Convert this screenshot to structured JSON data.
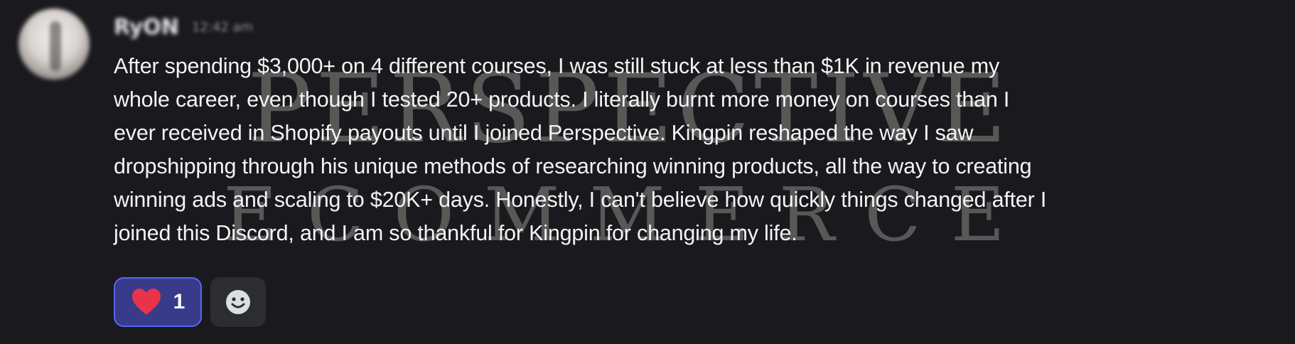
{
  "message": {
    "author": "RyON",
    "timestamp": "12:42 am",
    "content": "After spending $3,000+ on 4 different courses, I was still stuck at less than $1K in revenue my\nwhole career, even though I tested 20+ products. I literally burnt more money on courses than I\never received in Shopify payouts until I joined Perspective. Kingpin reshaped the way I saw\ndropshipping through his unique methods of researching winning products, all the way to creating\nwinning ads and scaling to $20K+ days. Honestly, I can't believe how quickly things changed after I\njoined this Discord, and I am so thankful for Kingpin for changing my life."
  },
  "watermark": {
    "line1": "PERSPECTIVE",
    "line2": "ECOMMERCE"
  },
  "reactions": [
    {
      "emoji": "heart-icon",
      "count": "1",
      "selected": true
    }
  ],
  "add_reaction": {
    "icon": "smile-icon"
  },
  "colors": {
    "background": "#1a1a1e",
    "text": "#f2f3f5",
    "reaction_selected_bg": "#383b8a",
    "reaction_selected_border": "#5865f2",
    "heart": "#e8334a"
  }
}
